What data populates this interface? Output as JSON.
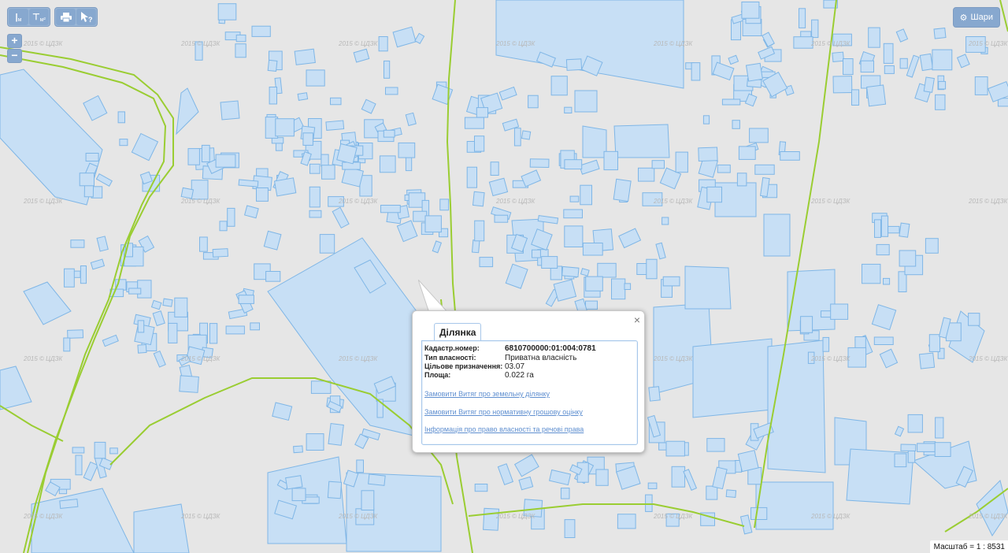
{
  "toolbar": {
    "measure_label": "м",
    "area_label": "м²",
    "print_icon": "printer-icon",
    "identify_icon": "cursor-question-icon",
    "layers_label": "Шари",
    "layers_icon": "gear-icon"
  },
  "zoom": {
    "in_label": "+",
    "out_label": "−"
  },
  "watermark": "2015 © ЦДЗК",
  "popup": {
    "tab_label": "Ділянка",
    "close_label": "×",
    "fields": [
      {
        "label": "Кадастр.номер:",
        "value": "6810700000:01:004:0781"
      },
      {
        "label": "Тип власності:",
        "value": "Приватна власність"
      },
      {
        "label": "Цільове призначення:",
        "value": "03.07"
      },
      {
        "label": "Площа:",
        "value": "0.022 га"
      }
    ],
    "links": [
      "Замовити Витяг про земельну ділянку",
      "Замовити Витяг про нормативну грошову оцінку",
      "Інформація про право власності та речові права"
    ]
  },
  "scale_text": "Масштаб = 1 : 8531",
  "colors": {
    "map_background": "#e6e6e6",
    "parcel_fill": "#c7dff5",
    "parcel_stroke": "#7fb6e6",
    "boundary": "#9acd32",
    "button": "#87a8cf",
    "link": "#5f8fd0"
  }
}
